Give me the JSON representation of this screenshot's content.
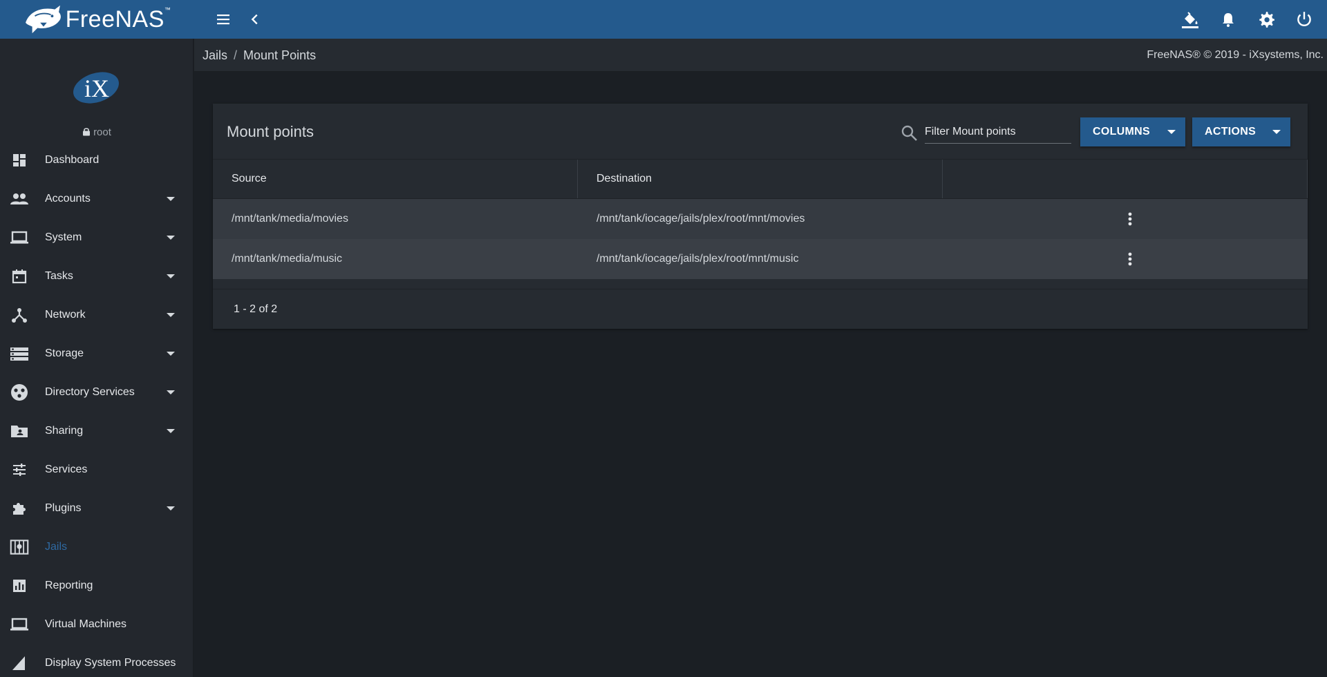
{
  "brand": {
    "name": "FreeNAS",
    "trademark": "™"
  },
  "topbar": {
    "menu_icon": "menu-icon",
    "back_icon": "chevron-left-icon",
    "right_icons": [
      "paint-bucket-icon",
      "bell-icon",
      "gear-icon",
      "power-icon"
    ]
  },
  "sidebar": {
    "logo": "iX",
    "user": "root",
    "items": [
      {
        "label": "Dashboard",
        "icon": "dashboard-icon",
        "has_caret": false
      },
      {
        "label": "Accounts",
        "icon": "people-icon",
        "has_caret": true
      },
      {
        "label": "System",
        "icon": "laptop-icon",
        "has_caret": true
      },
      {
        "label": "Tasks",
        "icon": "calendar-icon",
        "has_caret": true
      },
      {
        "label": "Network",
        "icon": "network-icon",
        "has_caret": true
      },
      {
        "label": "Storage",
        "icon": "storage-icon",
        "has_caret": true
      },
      {
        "label": "Directory Services",
        "icon": "directory-services-icon",
        "has_caret": true
      },
      {
        "label": "Sharing",
        "icon": "shared-folder-icon",
        "has_caret": true
      },
      {
        "label": "Services",
        "icon": "sliders-icon",
        "has_caret": false
      },
      {
        "label": "Plugins",
        "icon": "puzzle-icon",
        "has_caret": true
      },
      {
        "label": "Jails",
        "icon": "jail-icon",
        "has_caret": false,
        "active": true
      },
      {
        "label": "Reporting",
        "icon": "bar-chart-icon",
        "has_caret": false
      },
      {
        "label": "Virtual Machines",
        "icon": "laptop-icon",
        "has_caret": false
      },
      {
        "label": "Display System Processes",
        "icon": "triangle-icon",
        "has_caret": false
      }
    ]
  },
  "breadcrumb": {
    "parent": "Jails",
    "separator": "/",
    "current": "Mount Points"
  },
  "copyright": "FreeNAS® © 2019 - iXsystems, Inc.",
  "card": {
    "title": "Mount points",
    "filter_placeholder": "Filter Mount points",
    "columns_button": "COLUMNS",
    "actions_button": "ACTIONS",
    "headers": [
      "Source",
      "Destination",
      ""
    ],
    "rows": [
      {
        "source": "/mnt/tank/media/movies",
        "destination": "/mnt/tank/iocage/jails/plex/root/mnt/movies"
      },
      {
        "source": "/mnt/tank/media/music",
        "destination": "/mnt/tank/iocage/jails/plex/root/mnt/music"
      }
    ],
    "pagination": "1 - 2 of 2"
  },
  "colors": {
    "topbar": "#245a8d",
    "sidebar": "#23272d",
    "background": "#1b1f24",
    "card": "#262b31",
    "row_1": "#353a41",
    "row_2": "#3a3f46",
    "active_nav": "#2f6aa3"
  }
}
